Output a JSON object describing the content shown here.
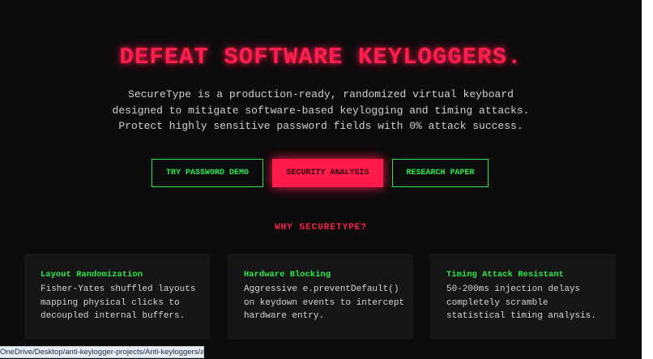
{
  "hero": {
    "title": "DEFEAT SOFTWARE KEYLOGGERS.",
    "subtitle_lines": [
      "SecureType is a production-ready, randomized virtual keyboard",
      "designed to mitigate software-based keylogging and timing attacks.",
      "Protect highly sensitive password fields with 0% attack success."
    ]
  },
  "buttons": {
    "demo": "TRY PASSWORD DEMO",
    "security": "SECURITY ANALYSIS",
    "paper": "RESEARCH PAPER"
  },
  "why": {
    "heading": "WHY SECURETYPE?",
    "cards": [
      {
        "title": "Layout Randomization",
        "lines": [
          "Fisher-Yates shuffled layouts",
          "mapping physical clicks to",
          "decoupled internal buffers."
        ]
      },
      {
        "title": "Hardware Blocking",
        "lines": [
          "Aggressive e.preventDefault()",
          "on keydown events to intercept",
          "hardware entry."
        ]
      },
      {
        "title": "Timing Attack Resistant",
        "lines": [
          "50-200ms injection delays",
          "completely scramble",
          "statistical timing analysis."
        ]
      }
    ]
  },
  "status_bar": {
    "url": "OneDrive/Desktop/anti-keylogger-projects/Anti-keyloggers/analysis.html"
  },
  "colors": {
    "accent_red": "#ff1f4f",
    "accent_green": "#2ee84e",
    "background": "#0c0c0c",
    "card_background": "#161616"
  }
}
